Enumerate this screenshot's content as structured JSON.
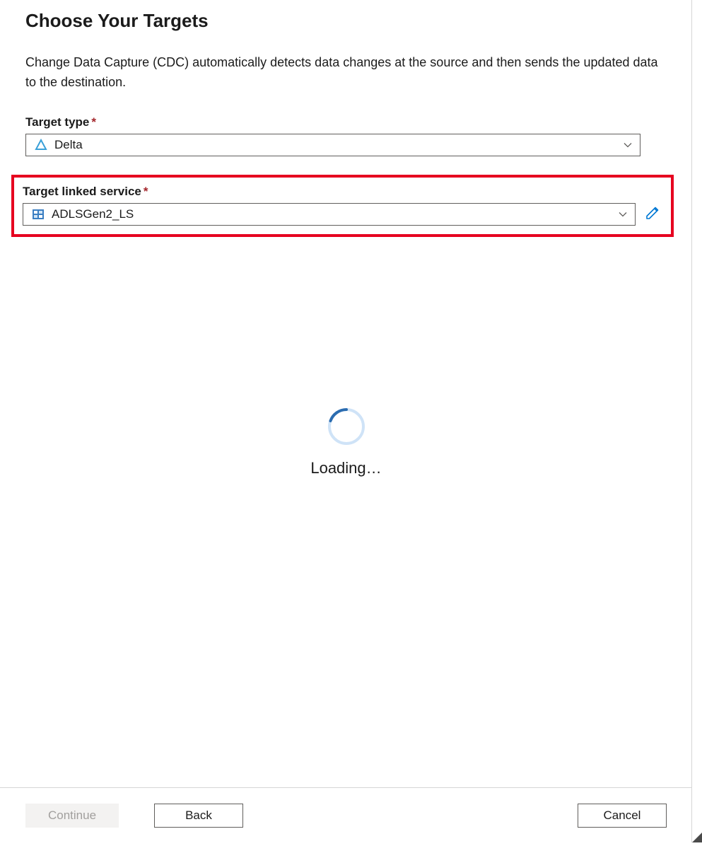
{
  "header": {
    "title": "Choose Your Targets",
    "description": "Change Data Capture (CDC) automatically detects data changes at the source and then sends the updated data to the destination."
  },
  "targetType": {
    "label": "Target type",
    "required": "*",
    "value": "Delta",
    "iconName": "delta-icon"
  },
  "linkedService": {
    "label": "Target linked service",
    "required": "*",
    "value": "ADLSGen2_LS",
    "iconName": "storage-icon"
  },
  "loading": {
    "text": "Loading…"
  },
  "footer": {
    "continue": "Continue",
    "back": "Back",
    "cancel": "Cancel"
  }
}
